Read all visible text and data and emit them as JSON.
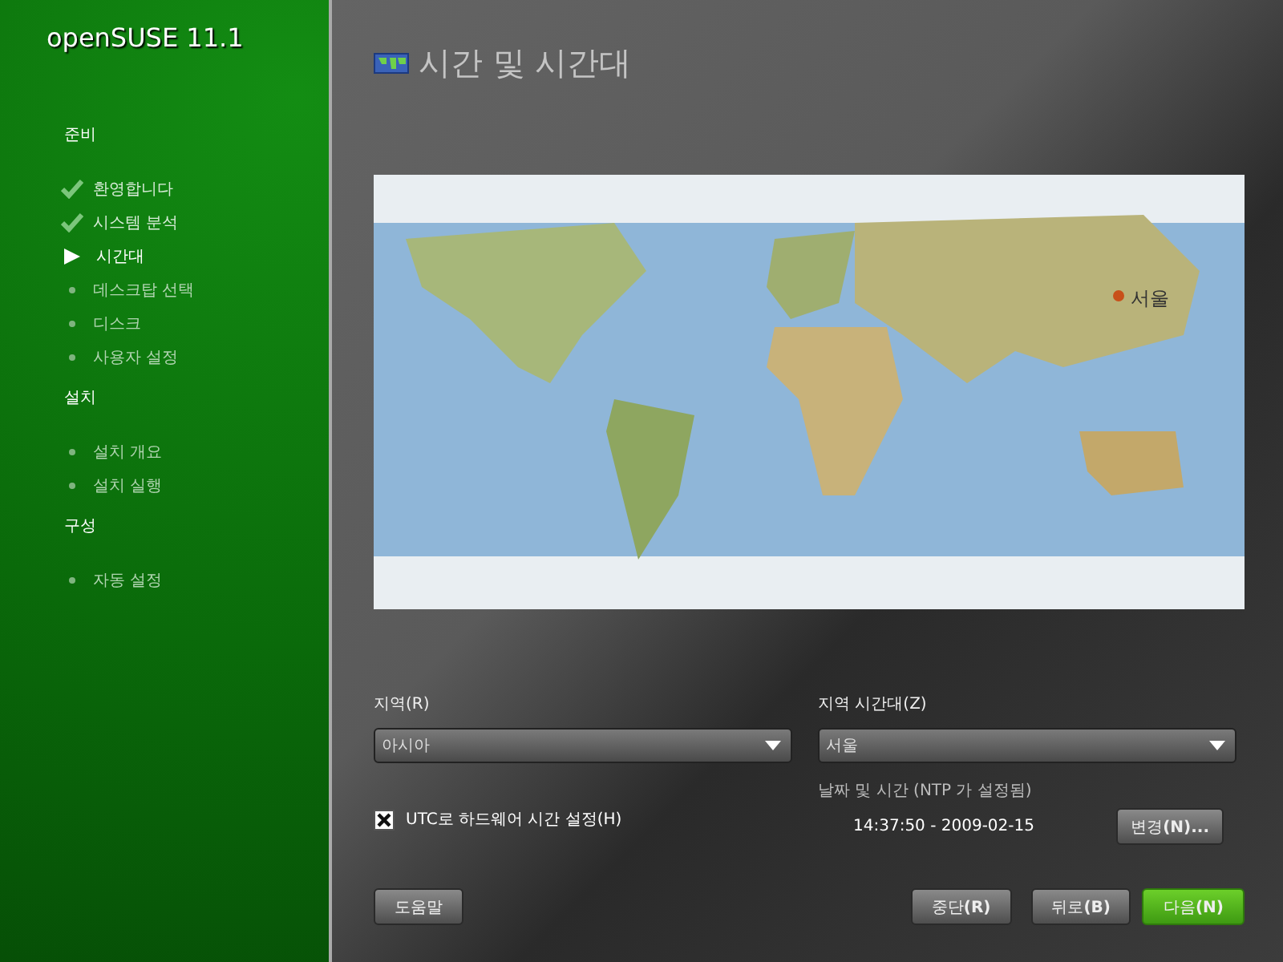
{
  "sidebar": {
    "logo": "openSUSE 11.1",
    "sections": [
      {
        "title": "준비",
        "items": [
          {
            "label": "환영합니다",
            "kind": "done"
          },
          {
            "label": "시스템 분석",
            "kind": "done"
          },
          {
            "label": "시간대",
            "kind": "current"
          },
          {
            "label": "데스크탑 선택",
            "kind": "pending"
          },
          {
            "label": "디스크",
            "kind": "pending"
          },
          {
            "label": "사용자 설정",
            "kind": "pending"
          }
        ]
      },
      {
        "title": "설치",
        "items": [
          {
            "label": "설치 개요",
            "kind": "pending"
          },
          {
            "label": "설치 실행",
            "kind": "pending"
          }
        ]
      },
      {
        "title": "구성",
        "items": [
          {
            "label": "자동 설정",
            "kind": "pending"
          }
        ]
      }
    ]
  },
  "page": {
    "title": "시간 및 시간대"
  },
  "map": {
    "marker_label": "서울"
  },
  "region": {
    "label": "지역(R)",
    "value": "아시아"
  },
  "timezone": {
    "label": "지역 시간대(Z)",
    "value": "서울"
  },
  "utc_checkbox": {
    "label": "UTC로 하드웨어 시간 설정(H)",
    "checked": true
  },
  "datetime": {
    "label": "날짜 및 시간 (NTP 가 설정됨)",
    "value": "14:37:50 - 2009-02-15",
    "button": "변경**(N)...**"
  },
  "buttons": {
    "help": "도움말",
    "abort": "중단**(R)**",
    "back": "뒤로**(B)**",
    "next": "다음**(N)**"
  }
}
